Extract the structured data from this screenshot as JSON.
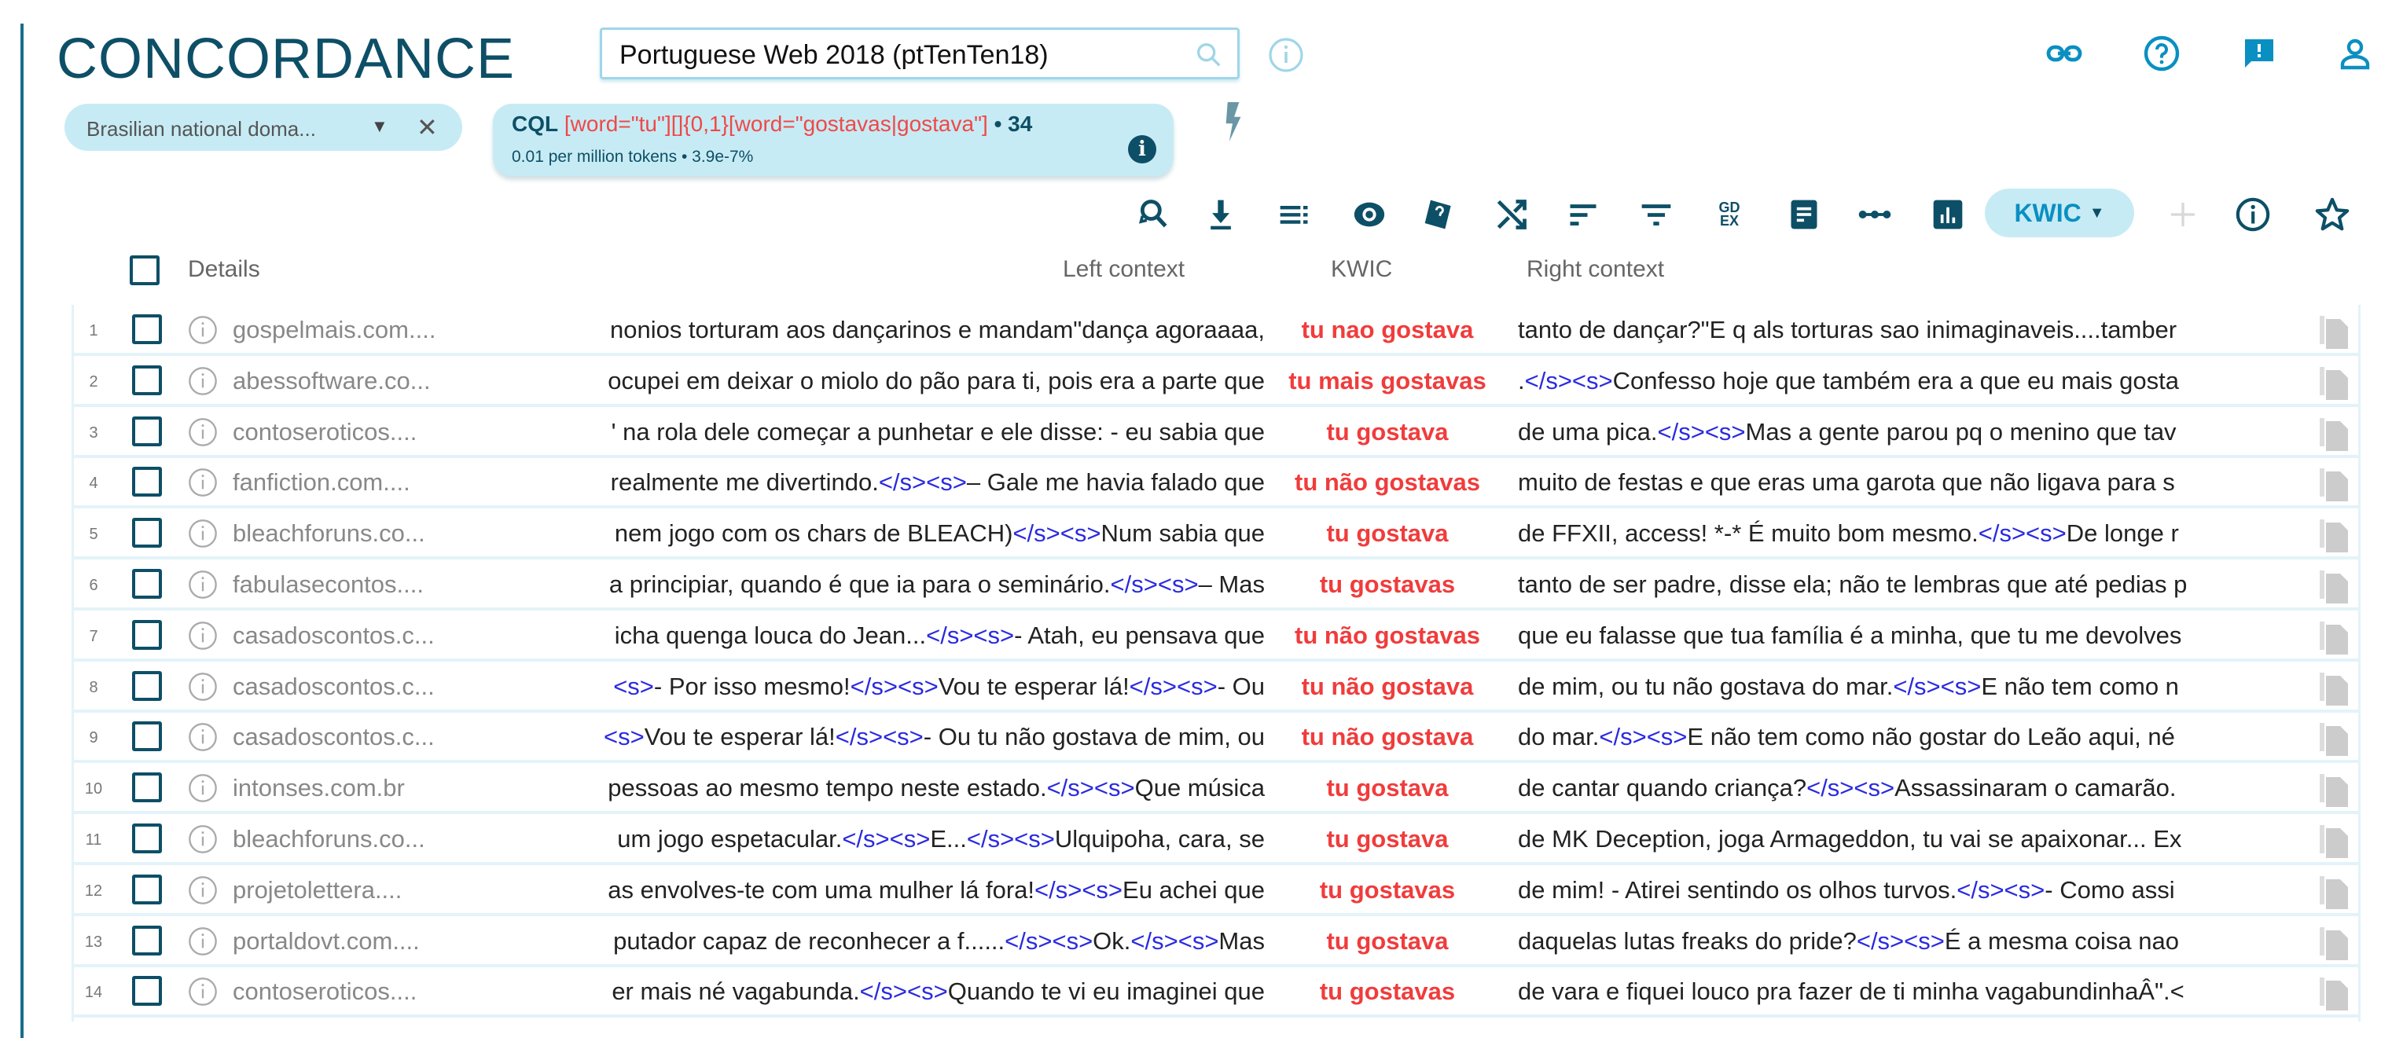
{
  "app": {
    "title": "CONCORDANCE"
  },
  "corpus": {
    "value": "Portuguese Web 2018 (ptTenTen18)"
  },
  "subcorpus": {
    "label": "Brasilian national doma..."
  },
  "query": {
    "type_label": "CQL",
    "cql": "[word=\"tu\"][]{0,1}[word=\"gostavas|gostava\"]",
    "count": "• 34",
    "stats": "0.01 per million tokens • 3.9e-7%"
  },
  "toolbar": {
    "view_label": "KWIC",
    "gdex_label": "GD EX"
  },
  "columns": {
    "details": "Details",
    "left": "Left context",
    "kwic": "KWIC",
    "right": "Right context"
  },
  "colors": {
    "accent": "#0d4f66",
    "bright": "#0a8fc2",
    "chip": "#c7ebf4",
    "kwic": "#f03c3c",
    "tag": "#2a2ae0"
  },
  "rows": [
    {
      "n": "1",
      "domain": "gospelmais.com....",
      "left": "nonios torturam aos dançarinos e mandam\"dança agoraaaa,",
      "kwic": "tu nao gostava",
      "right": "tanto de dançar?\"E q als torturas sao inimaginaveis....tamber"
    },
    {
      "n": "2",
      "domain": "abessoftware.co...",
      "left": "ocupei em deixar o miolo do pão para ti, pois era a parte que",
      "kwic": "tu mais gostavas",
      "right": ".</s><s>Confesso hoje que também era a que eu mais gosta"
    },
    {
      "n": "3",
      "domain": "contoseroticos....",
      "left": "' na rola dele começar a punhetar e ele disse: - eu sabia que",
      "kwic": "tu gostava",
      "right": "de uma pica.</s><s>Mas a gente parou pq o menino que tav"
    },
    {
      "n": "4",
      "domain": "fanfiction.com....",
      "left": "realmente me divertindo.</s><s>– Gale me havia falado que",
      "kwic": "tu não gostavas",
      "right": "muito de festas e que eras uma garota que não ligava para s"
    },
    {
      "n": "5",
      "domain": "bleachforuns.co...",
      "left": "nem jogo com os chars de BLEACH)</s><s>Num sabia que",
      "kwic": "tu gostava",
      "right": "de FFXII, access! *-* É muito bom mesmo.</s><s>De longe r"
    },
    {
      "n": "6",
      "domain": "fabulasecontos....",
      "left": "a principiar, quando é que ia para o seminário.</s><s>– Mas",
      "kwic": "tu gostavas",
      "right": "tanto de ser padre, disse ela; não te lembras que até pedias p"
    },
    {
      "n": "7",
      "domain": "casadoscontos.c...",
      "left": "icha quenga louca do Jean...</s><s>- Atah, eu pensava que",
      "kwic": "tu não gostavas",
      "right": "que eu falasse que tua família é a minha, que tu me devolves"
    },
    {
      "n": "8",
      "domain": "casadoscontos.c...",
      "left": "<s>- Por isso mesmo!</s><s>Vou te esperar lá!</s><s>- Ou",
      "kwic": "tu não gostava",
      "right": "de mim, ou tu não gostava do mar.</s><s>E não tem como n"
    },
    {
      "n": "9",
      "domain": "casadoscontos.c...",
      "left": "<s>Vou te esperar lá!</s><s>- Ou tu não gostava de mim, ou",
      "kwic": "tu não gostava",
      "right": "do mar.</s><s>E não tem como não gostar do Leão aqui, né"
    },
    {
      "n": "10",
      "domain": "intonses.com.br",
      "left": "pessoas ao mesmo tempo neste estado.</s><s>Que música",
      "kwic": "tu gostava",
      "right": "de cantar quando criança?</s><s>Assassinaram o camarão."
    },
    {
      "n": "11",
      "domain": "bleachforuns.co...",
      "left": "um jogo espetacular.</s><s>E...</s><s>Ulquipoha, cara, se",
      "kwic": "tu gostava",
      "right": "de MK Deception, joga Armageddon, tu vai se apaixonar... Ex"
    },
    {
      "n": "12",
      "domain": "projetolettera....",
      "left": "as envolves-te com uma mulher lá fora!</s><s>Eu achei que",
      "kwic": "tu gostavas",
      "right": "de mim! - Atirei sentindo os olhos turvos.</s><s>- Como assi"
    },
    {
      "n": "13",
      "domain": "portaldovt.com....",
      "left": "putador capaz de reconhecer a f......</s><s>Ok.</s><s>Mas",
      "kwic": "tu gostava",
      "right": "daquelas lutas freaks do pride?</s><s>É a mesma coisa nao"
    },
    {
      "n": "14",
      "domain": "contoseroticos....",
      "left": "er mais né vagabunda.</s><s>Quando te vi eu imaginei que",
      "kwic": "tu gostavas",
      "right": "de vara e fiquei louco pra fazer de ti minha vagabundinhaÂ\".<"
    }
  ]
}
